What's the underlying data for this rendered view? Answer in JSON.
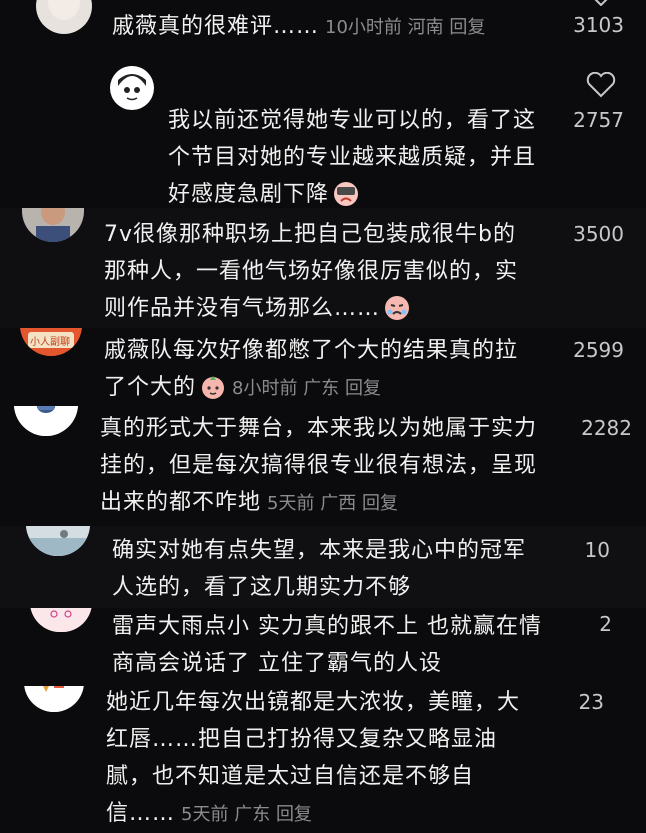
{
  "comments": [
    {
      "text": "戚薇真的很难评……",
      "time": "10小时前",
      "region": "河南",
      "reply": "回复",
      "likes": "3103"
    },
    {
      "text": "我以前还觉得她专业可以的，看了这个节目对她的专业越来越质疑，并且好感度急剧下降",
      "likes": "2757"
    },
    {
      "text": "7v很像那种职场上把自己包装成很牛b的那种人，一看他气场好像很厉害似的，实则作品并没有气场那么……",
      "likes": "3500"
    },
    {
      "avatar_text": "小人副聊",
      "text": "戚薇队每次好像都憋了个大的结果真的拉了个大的",
      "time": "8小时前",
      "region": "广东",
      "reply": "回复",
      "likes": "2599"
    },
    {
      "text": "真的形式大于舞台，本来我以为她属于实力挂的，但是每次搞得很专业很有想法，呈现出来的都不咋地",
      "time": "5天前",
      "region": "广西",
      "reply": "回复",
      "likes": "2282"
    },
    {
      "text": "确实对她有点失望，本来是我心中的冠军人选的，看了这几期实力不够",
      "likes": "10"
    },
    {
      "text": "雷声大雨点小 实力真的跟不上 也就赢在情商高会说话了 立住了霸气的人设",
      "likes": "2"
    },
    {
      "text": "她近几年每次出镜都是大浓妆，美瞳，大红唇……把自己打扮得又复杂又略显油腻，也不知道是太过自信还是不够自信……",
      "time": "5天前",
      "region": "广东",
      "reply": "回复",
      "likes": "23"
    }
  ],
  "colors": {
    "background": "#0b0b0d",
    "text": "#f0f0f0",
    "meta": "#8b8b90",
    "likes": "#c8c8cc"
  },
  "icons": [
    "heart-icon",
    "sad-emoji-icon",
    "crying-emoji-icon",
    "peach-emoji-icon"
  ]
}
